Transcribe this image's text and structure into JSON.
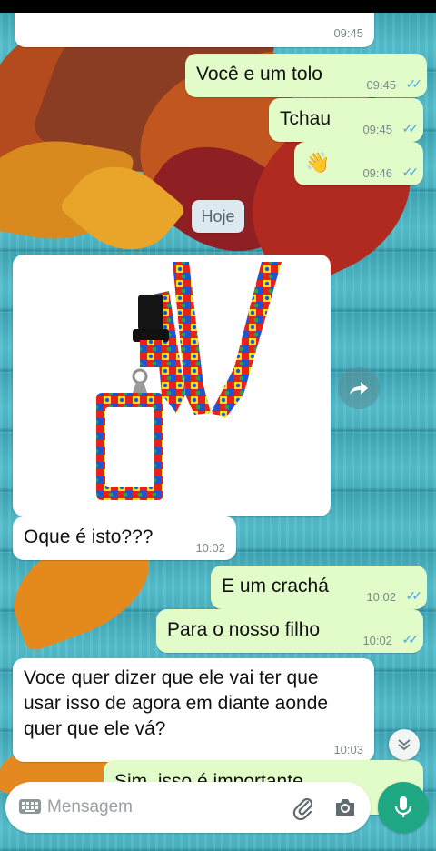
{
  "chat": {
    "messages": [
      {
        "dir": "in",
        "text": "",
        "time": "09:45"
      },
      {
        "dir": "out",
        "text": "Você e um tolo",
        "time": "09:45"
      },
      {
        "dir": "out",
        "text": "Tchau",
        "time": "09:45"
      },
      {
        "dir": "out",
        "text": "👋",
        "time": "09:46"
      },
      {
        "dir": "in",
        "text": "Oque é isto???",
        "time": "10:02"
      },
      {
        "dir": "out",
        "text": "E um crachá",
        "time": "10:02"
      },
      {
        "dir": "out",
        "text": "Para o nosso filho",
        "time": "10:02"
      },
      {
        "dir": "in",
        "text": "Voce quer dizer que ele vai ter que usar isso de agora em diante aonde quer que ele vá?",
        "time": "10:03"
      },
      {
        "dir": "out",
        "text": "Sim, isso é importante",
        "time": ""
      }
    ],
    "day_separator": "Hoje",
    "image_message": {
      "subject": "autism puzzle lanyard badge holder"
    }
  },
  "composer": {
    "placeholder": "Mensagem"
  },
  "colors": {
    "incoming": "#ffffff",
    "outgoing": "#e1fcc9",
    "accent": "#1fa783",
    "ticks": "#4aa7e8"
  },
  "icons": [
    "keyboard-icon",
    "attach-icon",
    "camera-icon",
    "mic-icon",
    "forward-icon",
    "scroll-down-icon",
    "read-ticks-icon"
  ]
}
